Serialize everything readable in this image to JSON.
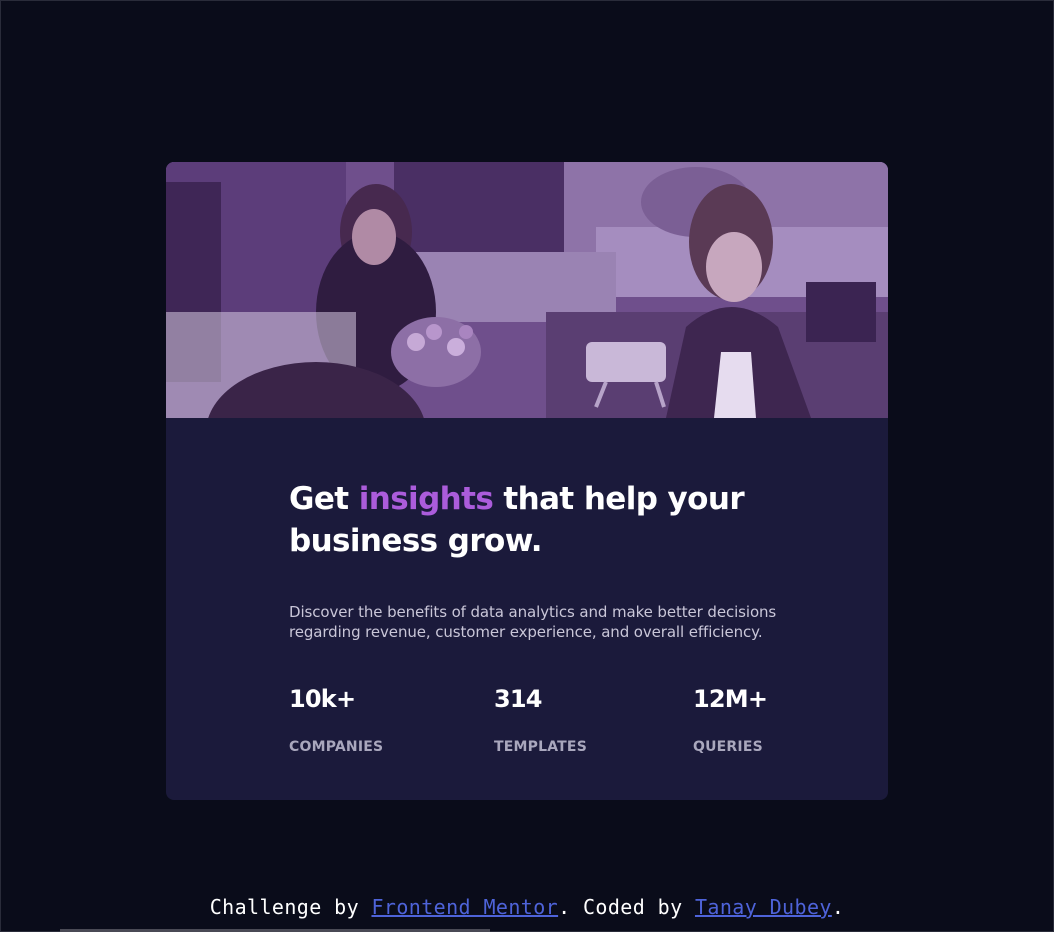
{
  "card": {
    "headline": {
      "before": "Get",
      "accent": "insights",
      "after": "that help your business grow."
    },
    "description": "Discover the benefits of data analytics and make better decisions regarding revenue, customer experience, and overall efficiency.",
    "stats": [
      {
        "value": "10k+",
        "label": "COMPANIES"
      },
      {
        "value": "314",
        "label": "TEMPLATES"
      },
      {
        "value": "12M+",
        "label": "QUERIES"
      }
    ]
  },
  "footer": {
    "prefix": "Challenge by",
    "link1": "Frontend Mentor",
    "middle": ". Coded by",
    "link2": "Tanay Dubey",
    "suffix": "."
  },
  "colors": {
    "page_background": "#0a0c1a",
    "card_background": "#1b1a3b",
    "accent": "#ab5cdb",
    "image_tint": "#6f4f8c",
    "link": "#4e63d9"
  }
}
